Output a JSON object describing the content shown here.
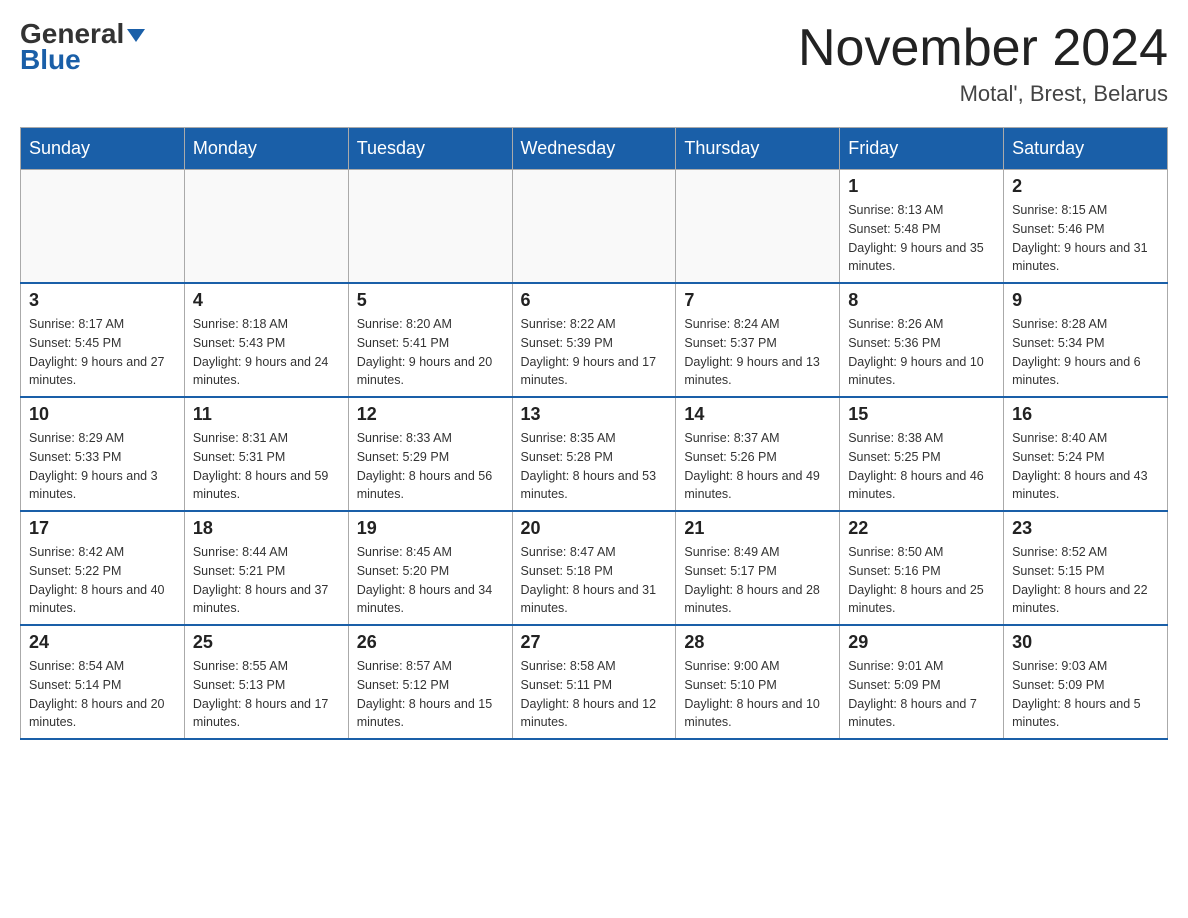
{
  "header": {
    "logo_general": "General",
    "logo_blue": "Blue",
    "month_title": "November 2024",
    "location": "Motal', Brest, Belarus"
  },
  "calendar": {
    "days_of_week": [
      "Sunday",
      "Monday",
      "Tuesday",
      "Wednesday",
      "Thursday",
      "Friday",
      "Saturday"
    ],
    "weeks": [
      [
        {
          "day": "",
          "info": ""
        },
        {
          "day": "",
          "info": ""
        },
        {
          "day": "",
          "info": ""
        },
        {
          "day": "",
          "info": ""
        },
        {
          "day": "",
          "info": ""
        },
        {
          "day": "1",
          "info": "Sunrise: 8:13 AM\nSunset: 5:48 PM\nDaylight: 9 hours and 35 minutes."
        },
        {
          "day": "2",
          "info": "Sunrise: 8:15 AM\nSunset: 5:46 PM\nDaylight: 9 hours and 31 minutes."
        }
      ],
      [
        {
          "day": "3",
          "info": "Sunrise: 8:17 AM\nSunset: 5:45 PM\nDaylight: 9 hours and 27 minutes."
        },
        {
          "day": "4",
          "info": "Sunrise: 8:18 AM\nSunset: 5:43 PM\nDaylight: 9 hours and 24 minutes."
        },
        {
          "day": "5",
          "info": "Sunrise: 8:20 AM\nSunset: 5:41 PM\nDaylight: 9 hours and 20 minutes."
        },
        {
          "day": "6",
          "info": "Sunrise: 8:22 AM\nSunset: 5:39 PM\nDaylight: 9 hours and 17 minutes."
        },
        {
          "day": "7",
          "info": "Sunrise: 8:24 AM\nSunset: 5:37 PM\nDaylight: 9 hours and 13 minutes."
        },
        {
          "day": "8",
          "info": "Sunrise: 8:26 AM\nSunset: 5:36 PM\nDaylight: 9 hours and 10 minutes."
        },
        {
          "day": "9",
          "info": "Sunrise: 8:28 AM\nSunset: 5:34 PM\nDaylight: 9 hours and 6 minutes."
        }
      ],
      [
        {
          "day": "10",
          "info": "Sunrise: 8:29 AM\nSunset: 5:33 PM\nDaylight: 9 hours and 3 minutes."
        },
        {
          "day": "11",
          "info": "Sunrise: 8:31 AM\nSunset: 5:31 PM\nDaylight: 8 hours and 59 minutes."
        },
        {
          "day": "12",
          "info": "Sunrise: 8:33 AM\nSunset: 5:29 PM\nDaylight: 8 hours and 56 minutes."
        },
        {
          "day": "13",
          "info": "Sunrise: 8:35 AM\nSunset: 5:28 PM\nDaylight: 8 hours and 53 minutes."
        },
        {
          "day": "14",
          "info": "Sunrise: 8:37 AM\nSunset: 5:26 PM\nDaylight: 8 hours and 49 minutes."
        },
        {
          "day": "15",
          "info": "Sunrise: 8:38 AM\nSunset: 5:25 PM\nDaylight: 8 hours and 46 minutes."
        },
        {
          "day": "16",
          "info": "Sunrise: 8:40 AM\nSunset: 5:24 PM\nDaylight: 8 hours and 43 minutes."
        }
      ],
      [
        {
          "day": "17",
          "info": "Sunrise: 8:42 AM\nSunset: 5:22 PM\nDaylight: 8 hours and 40 minutes."
        },
        {
          "day": "18",
          "info": "Sunrise: 8:44 AM\nSunset: 5:21 PM\nDaylight: 8 hours and 37 minutes."
        },
        {
          "day": "19",
          "info": "Sunrise: 8:45 AM\nSunset: 5:20 PM\nDaylight: 8 hours and 34 minutes."
        },
        {
          "day": "20",
          "info": "Sunrise: 8:47 AM\nSunset: 5:18 PM\nDaylight: 8 hours and 31 minutes."
        },
        {
          "day": "21",
          "info": "Sunrise: 8:49 AM\nSunset: 5:17 PM\nDaylight: 8 hours and 28 minutes."
        },
        {
          "day": "22",
          "info": "Sunrise: 8:50 AM\nSunset: 5:16 PM\nDaylight: 8 hours and 25 minutes."
        },
        {
          "day": "23",
          "info": "Sunrise: 8:52 AM\nSunset: 5:15 PM\nDaylight: 8 hours and 22 minutes."
        }
      ],
      [
        {
          "day": "24",
          "info": "Sunrise: 8:54 AM\nSunset: 5:14 PM\nDaylight: 8 hours and 20 minutes."
        },
        {
          "day": "25",
          "info": "Sunrise: 8:55 AM\nSunset: 5:13 PM\nDaylight: 8 hours and 17 minutes."
        },
        {
          "day": "26",
          "info": "Sunrise: 8:57 AM\nSunset: 5:12 PM\nDaylight: 8 hours and 15 minutes."
        },
        {
          "day": "27",
          "info": "Sunrise: 8:58 AM\nSunset: 5:11 PM\nDaylight: 8 hours and 12 minutes."
        },
        {
          "day": "28",
          "info": "Sunrise: 9:00 AM\nSunset: 5:10 PM\nDaylight: 8 hours and 10 minutes."
        },
        {
          "day": "29",
          "info": "Sunrise: 9:01 AM\nSunset: 5:09 PM\nDaylight: 8 hours and 7 minutes."
        },
        {
          "day": "30",
          "info": "Sunrise: 9:03 AM\nSunset: 5:09 PM\nDaylight: 8 hours and 5 minutes."
        }
      ]
    ]
  }
}
